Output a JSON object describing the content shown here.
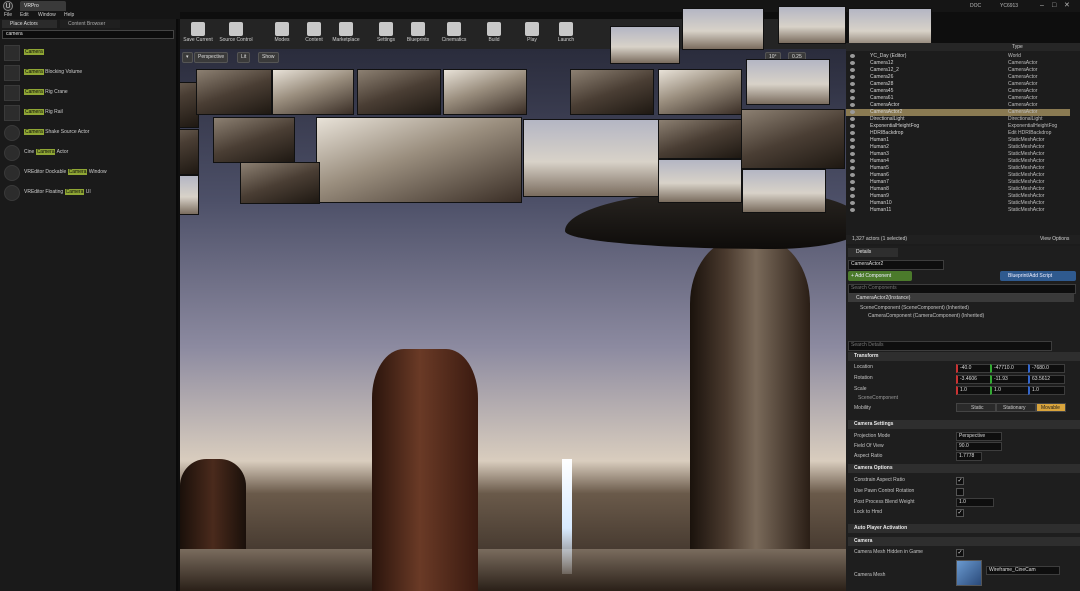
{
  "app": {
    "level_tab": "VRPro",
    "menu": [
      "File",
      "Edit",
      "Window",
      "Help"
    ],
    "right_title": [
      "DOC",
      "YC6913"
    ]
  },
  "left_panel": {
    "tabs": [
      "Place Actors",
      "Content Browser"
    ],
    "search_value": "camera",
    "results": [
      {
        "pre": "",
        "match": "Camera",
        "post": ""
      },
      {
        "pre": "",
        "match": "Camera",
        "post": " Blocking Volume"
      },
      {
        "pre": "",
        "match": "Camera",
        "post": " Rig Crane"
      },
      {
        "pre": "",
        "match": "Camera",
        "post": " Rig Rail"
      },
      {
        "pre": "",
        "match": "Camera",
        "post": " Shake Source Actor"
      },
      {
        "pre": "Cine ",
        "match": "Camera",
        "post": " Actor"
      },
      {
        "pre": "VREditor Dockable ",
        "match": "Camera",
        "post": " Window"
      },
      {
        "pre": "VREditor Floating ",
        "match": "Camera",
        "post": " UI"
      }
    ]
  },
  "toolbar": {
    "buttons": [
      "Save Current",
      "Source Control",
      "Modes",
      "Content",
      "Marketplace",
      "Settings",
      "Blueprints",
      "Cinematics",
      "Build",
      "Play",
      "Launch"
    ]
  },
  "viewport": {
    "buttons": [
      "Perspective",
      "Lit",
      "Show"
    ],
    "right_values": [
      "10°",
      "0.25"
    ]
  },
  "outliner": {
    "header_type": "Type",
    "rows": [
      {
        "name": "YC_Day (Editor)",
        "type": "World"
      },
      {
        "name": "Camera12",
        "type": "CameraActor"
      },
      {
        "name": "Camera12_2",
        "type": "CameraActor"
      },
      {
        "name": "Camera26",
        "type": "CameraActor"
      },
      {
        "name": "Camera28",
        "type": "CameraActor"
      },
      {
        "name": "Camera45",
        "type": "CameraActor"
      },
      {
        "name": "Camera61",
        "type": "CameraActor"
      },
      {
        "name": "CameraActor",
        "type": "CameraActor"
      },
      {
        "name": "CameraActor2",
        "type": "CameraActor",
        "selected": true
      },
      {
        "name": "DirectionalLight",
        "type": "DirectionalLight"
      },
      {
        "name": "ExponentialHeightFog",
        "type": "ExponentialHeightFog"
      },
      {
        "name": "HDRIBackdrop",
        "type": "Edit HDRIBackdrop"
      },
      {
        "name": "Human1",
        "type": "StaticMeshActor"
      },
      {
        "name": "Human2",
        "type": "StaticMeshActor"
      },
      {
        "name": "Human3",
        "type": "StaticMeshActor"
      },
      {
        "name": "Human4",
        "type": "StaticMeshActor"
      },
      {
        "name": "Human5",
        "type": "StaticMeshActor"
      },
      {
        "name": "Human6",
        "type": "StaticMeshActor"
      },
      {
        "name": "Human7",
        "type": "StaticMeshActor"
      },
      {
        "name": "Human8",
        "type": "StaticMeshActor"
      },
      {
        "name": "Human9",
        "type": "StaticMeshActor"
      },
      {
        "name": "Human10",
        "type": "StaticMeshActor"
      },
      {
        "name": "Human11",
        "type": "StaticMeshActor"
      }
    ],
    "footer_count": "1,327 actors (1 selected)",
    "footer_view": "View Options"
  },
  "details": {
    "tab": "Details",
    "actor_name": "CameraActor2",
    "add_component": "+ Add Component",
    "blueprint": "Blueprint/Add Script",
    "search_placeholder": "Search Components",
    "components": [
      "CameraActor2(Instance)",
      "SceneComponent (SceneComponent) (Inherited)",
      "CameraComponent (CameraComponent) (Inherited)"
    ],
    "search_details_placeholder": "Search Details",
    "transform": {
      "title": "Transform",
      "labels": [
        "Location",
        "Rotation",
        "Scale"
      ],
      "location": [
        "-40.0",
        "-47710.0",
        "-7680.0"
      ],
      "rotation": [
        "-3.4606",
        "-11.93",
        "63.5612"
      ],
      "scale": [
        "1.0",
        "1.0",
        "1.0"
      ],
      "scene_component": "SceneComponent",
      "mobility_label": "Mobility",
      "mobility_options": [
        "Static",
        "Stationary",
        "Movable"
      ]
    },
    "camera_settings": {
      "title": "Camera Settings",
      "props": [
        {
          "label": "Projection Mode",
          "value": "Perspective"
        },
        {
          "label": "Field Of View",
          "value": "90.0"
        },
        {
          "label": "Aspect Ratio",
          "value": "1.7778"
        }
      ]
    },
    "camera_options": {
      "title": "Camera Options",
      "props": [
        "Constrain Aspect Ratio",
        "Use Pawn Control Rotation",
        "Post Process Blend Weight",
        "Lock to Hmd"
      ],
      "blend_weight": "1.0"
    },
    "auto_player": "Auto Player Activation",
    "camera": {
      "title": "Camera",
      "props": [
        "Camera Mesh Hidden in Game",
        "Camera Mesh"
      ],
      "mesh_value": "Wireframe_CineCam"
    }
  }
}
